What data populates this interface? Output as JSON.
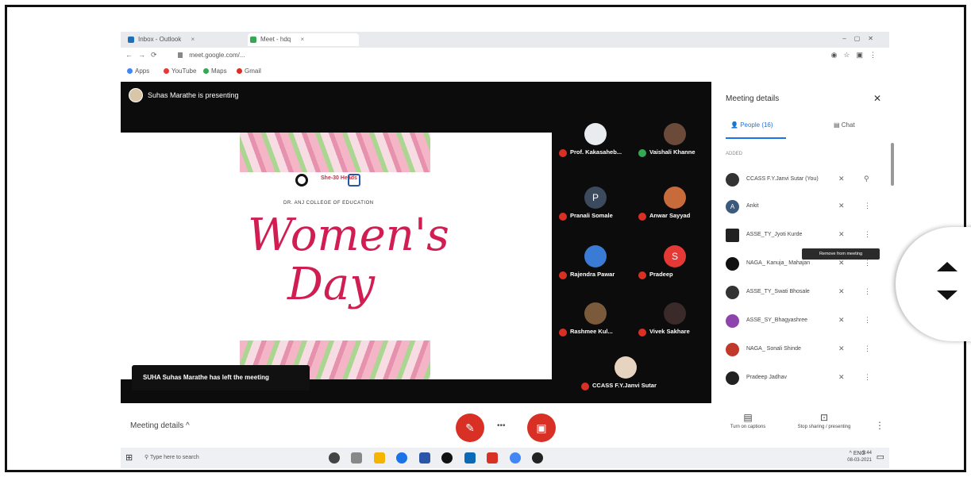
{
  "browser": {
    "tabs": [
      {
        "label": "Inbox - Outlook"
      },
      {
        "label": "Meet - hdq"
      }
    ],
    "tab_close": "×",
    "url": "meet.google.com/...",
    "bookmarks": [
      "Apps",
      "YouTube",
      "Maps",
      "Gmail"
    ]
  },
  "meet": {
    "presenter_banner": "Suhas Marathe is presenting",
    "left_notice": "SUHA Suhas Marathe has left the meeting",
    "slide": {
      "subtitle": "DR. ANJ COLLEGE OF EDUCATION",
      "logo_text": "She-30 Heads",
      "title_line1": "Women's",
      "title_line2": "Day"
    },
    "participants": [
      {
        "name": "Prof. Kakasaheb...",
        "color": "#e9ecef"
      },
      {
        "name": "Vaishali Khanne",
        "color": "#6b4a3a"
      },
      {
        "name": "Pranali Somale",
        "color": "#3c4a5e",
        "initial": "P"
      },
      {
        "name": "Anwar Sayyad",
        "color": "#c86b3b"
      },
      {
        "name": "Rajendra Pawar",
        "color": "#3a7bd5"
      },
      {
        "name": "Pradeep",
        "color": "#e53935",
        "initial": "S"
      },
      {
        "name": "Rashmee Kul...",
        "color": "#7a5a3a"
      },
      {
        "name": "Vivek Sakhare",
        "color": "#3a2a2a"
      },
      {
        "name": "CCASS F.Y.Janvi Sutar",
        "color": "#e6d3c0"
      }
    ],
    "meeting_details_label": "Meeting details ^",
    "more_dots": "•••",
    "bottom_right": [
      {
        "icon": "▤",
        "label": "Turn on captions"
      },
      {
        "icon": "⊡",
        "label": "Stop sharing / presenting"
      }
    ]
  },
  "panel": {
    "title": "Meeting details",
    "close": "✕",
    "tabs": {
      "people": "People (16)",
      "chat": "Chat"
    },
    "subheader": "ADDED",
    "people": [
      {
        "name": "CCASS F.Y.Janvi Sutar (You)",
        "color": "#333333",
        "initial": ""
      },
      {
        "name": "Ankit",
        "color": "#3c5a7e",
        "initial": "A"
      },
      {
        "name": "ASSE_TY_Jyoti Kurde",
        "color": "#222222",
        "initial": ""
      },
      {
        "name": "NAGA_ Kanuja_ Mahajan",
        "color": "#111111",
        "initial": ""
      },
      {
        "name": "ASSE_TY_Swati Bhosale",
        "color": "#333333",
        "initial": ""
      },
      {
        "name": "ASSE_SY_Bhagyashree",
        "color": "#8e44ad",
        "initial": ""
      },
      {
        "name": "NAGA_ Sonali Shinde",
        "color": "#c0392b",
        "initial": ""
      },
      {
        "name": "Pradeep Jadhav",
        "color": "#222222",
        "initial": ""
      }
    ],
    "tooltip": "Remove from meeting"
  },
  "taskbar": {
    "search_placeholder": "Type here to search",
    "tray": "^ ENG",
    "time": "9:44",
    "date": "08-03-2021"
  }
}
